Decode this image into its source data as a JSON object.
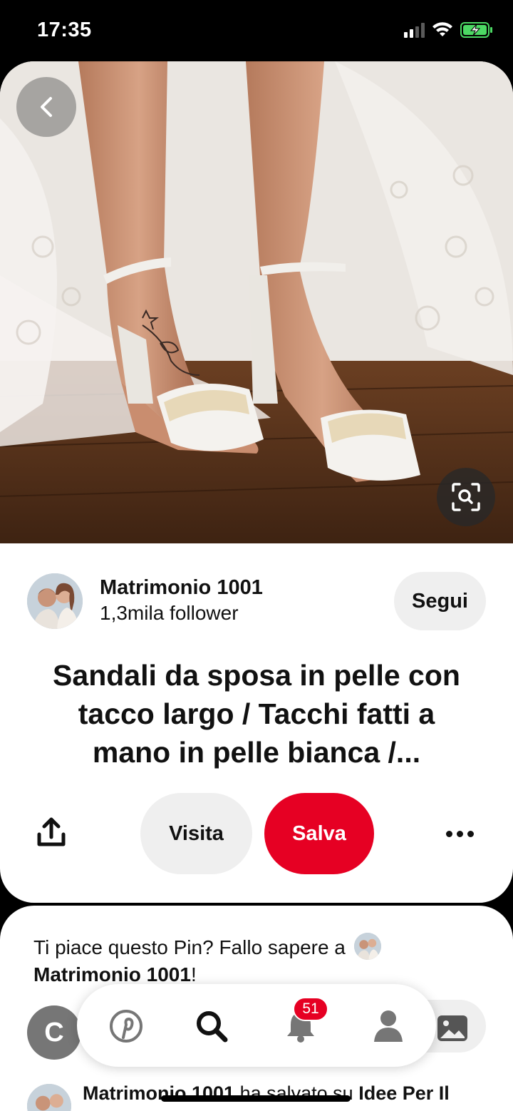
{
  "status_bar": {
    "time": "17:35"
  },
  "pin": {
    "icons": {
      "back": "chevron-left-icon",
      "visual_search": "visual-search-icon",
      "share": "share-icon",
      "more": "more-icon"
    },
    "creator": {
      "name": "Matrimonio 1001",
      "followers": "1,3mila follower",
      "follow_label": "Segui"
    },
    "title_line1": "Sandali da sposa in pelle con",
    "title_line2": "tacco largo / Tacchi fatti a",
    "title_line3": "mano in pelle bianca /...",
    "actions": {
      "visit_label": "Visita",
      "save_label": "Salva"
    }
  },
  "comment_prompt": {
    "text_before": "Ti piace questo Pin? Fallo sapere a",
    "creator_name": "Matrimonio 1001",
    "text_after": "!"
  },
  "saved_activity": {
    "creator_name": "Matrimonio 1001",
    "action_text": "ha salvato su",
    "board_name": "Idee Per Il"
  },
  "bottom_nav": {
    "user_initial": "C",
    "notification_count": "51",
    "items": [
      "pinterest-logo-icon",
      "search-icon",
      "bell-icon",
      "profile-icon"
    ]
  },
  "colors": {
    "brand_red": "#e60023",
    "pill_gray": "#efefef"
  }
}
